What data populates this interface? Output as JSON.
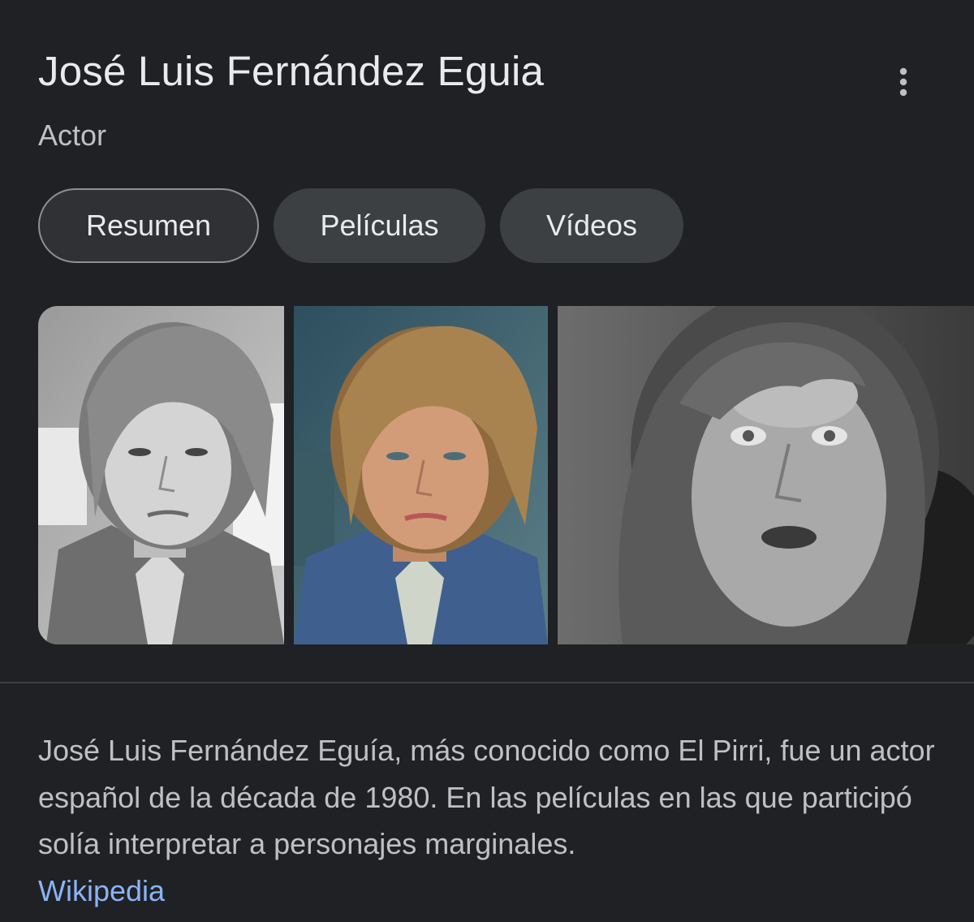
{
  "panel": {
    "title": "José Luis Fernández Eguia",
    "subtitle": "Actor",
    "more_options_icon": "more-vert-icon"
  },
  "tabs": [
    {
      "label": "Resumen",
      "selected": true
    },
    {
      "label": "Películas",
      "selected": false
    },
    {
      "label": "Vídeos",
      "selected": false
    }
  ],
  "images": [
    {
      "description_icon": "photo-thumbnail",
      "style": "black-and-white"
    },
    {
      "description_icon": "photo-thumbnail",
      "style": "color"
    },
    {
      "description_icon": "photo-thumbnail",
      "style": "black-and-white"
    }
  ],
  "description": {
    "text": "José Luis Fernández Eguía, más conocido como El Pirri, fue un actor español de la década de 1980. En las películas en las que participó solía interpretar a personajes marginales.",
    "source_label": "Wikipedia"
  },
  "colors": {
    "background": "#202124",
    "title": "#e8eaed",
    "subtitle": "#bdc1c6",
    "chip": "#3c4043",
    "link": "#8ab4f8"
  }
}
